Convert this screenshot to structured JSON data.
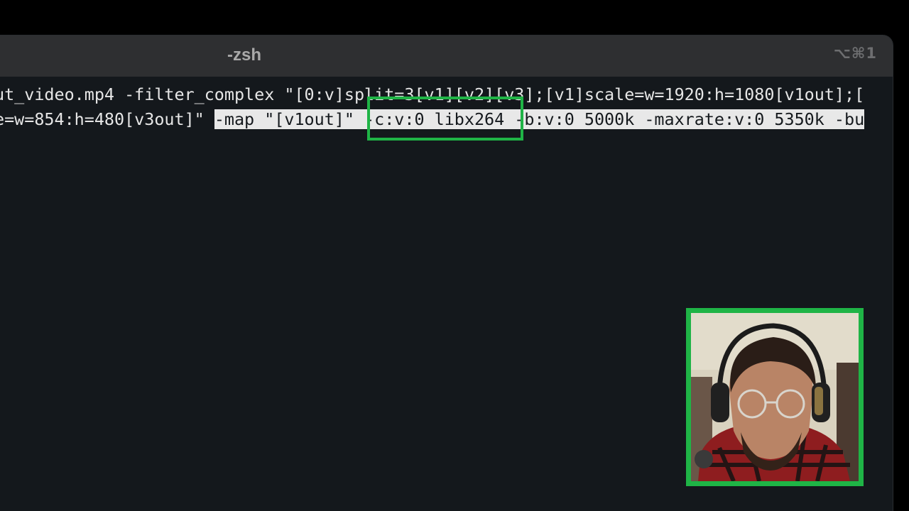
{
  "window": {
    "title": "-zsh",
    "shortcut": "⌥⌘1"
  },
  "terminal": {
    "line1": "ut_video.mp4 -filter_complex \"[0:v]split=3[v1][v2][v3];[v1]scale=w=1920:h=1080[v1out];[",
    "line2_plain": "e=w=854:h=480[v3out]\" ",
    "line2_selected": "-map \"[v1out]\" -c:v:0 libx264 -b:v:0 5000k -maxrate:v:0 5350k -bu"
  },
  "highlight": {
    "label": "-c:v:0 libx264",
    "color": "#1fb446"
  },
  "webcam": {
    "frame_color": "#1fb446"
  },
  "colors": {
    "background": "#14181c",
    "titlebar": "#2e2f31",
    "text": "#e6e6e6",
    "selection": "#e8e8e8"
  }
}
